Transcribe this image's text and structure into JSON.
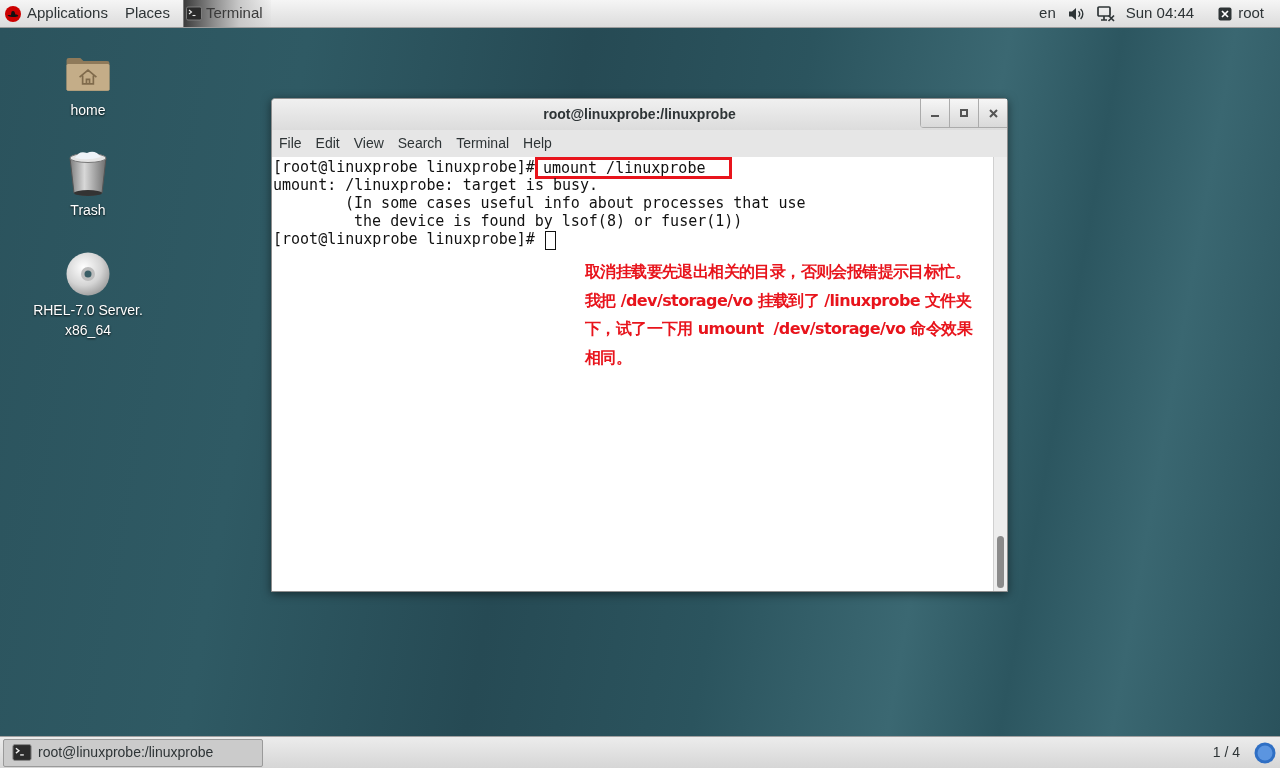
{
  "top_bar": {
    "menus": [
      "Applications",
      "Places"
    ],
    "app_button": "Terminal",
    "input_source": "en",
    "clock": "Sun 04:44",
    "user": "root"
  },
  "desktop_icons": [
    {
      "kind": "folder",
      "lines": [
        "home"
      ]
    },
    {
      "kind": "trash",
      "lines": [
        "Trash"
      ]
    },
    {
      "kind": "disc",
      "lines": [
        "RHEL-7.0 Server.",
        "x86_64"
      ]
    }
  ],
  "terminal": {
    "title": "root@linuxprobe:/linuxprobe",
    "menu": [
      "File",
      "Edit",
      "View",
      "Search",
      "Terminal",
      "Help"
    ],
    "lines": [
      {
        "kind": "command",
        "prompt": "[root@linuxprobe linuxprobe]#",
        "command": "umount /linuxprobe",
        "highlighted": true
      },
      {
        "kind": "output",
        "text": "umount: /linuxprobe: target is busy."
      },
      {
        "kind": "continuation",
        "text": "(In some cases useful info about processes that use"
      },
      {
        "kind": "continuation",
        "text": " the device is found by lsof(8) or fuser(1))"
      },
      {
        "kind": "prompt",
        "prompt": "[root@linuxprobe linuxprobe]#",
        "cursor": true
      }
    ]
  },
  "annotation": {
    "text": "取消挂载要先退出相关的目录，否则会报错提示目标忙。我把 /dev/storage/vo 挂载到了 /linuxprobe 文件夹下，试了一下用 umount  /dev/storage/vo 命令效果相同。"
  },
  "bottom_bar": {
    "task": "root@linuxprobe:/linuxprobe",
    "workspace": "1 / 4"
  }
}
